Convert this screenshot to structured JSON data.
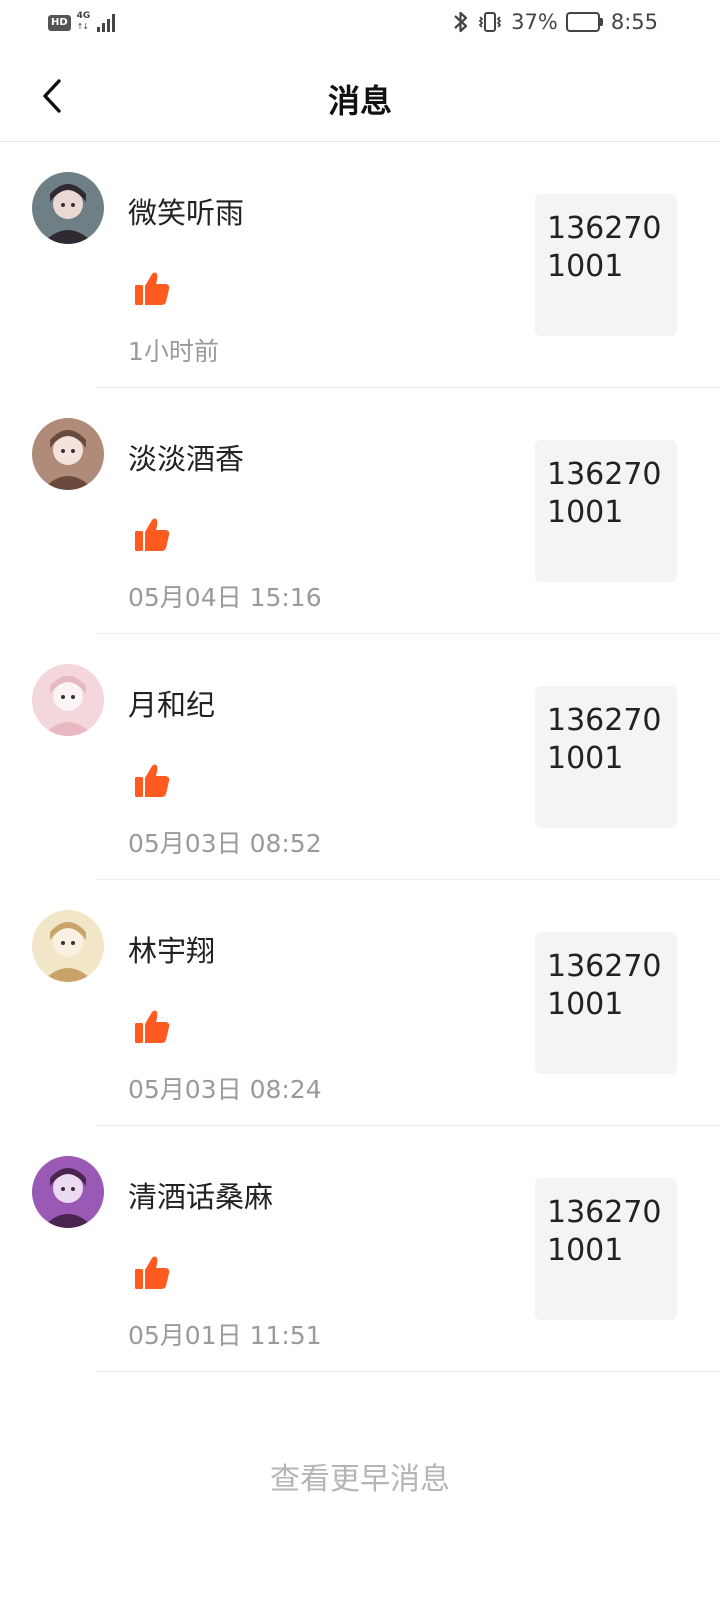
{
  "status_bar": {
    "hd_badge": "HD",
    "network": "4G",
    "battery_percent_label": "37%",
    "battery_level": 0.37,
    "time": "8:55",
    "icons": [
      "hd-icon",
      "network-4g-icon",
      "signal-icon",
      "bluetooth-icon",
      "vibrate-icon",
      "battery-icon"
    ]
  },
  "header": {
    "title": "消息",
    "back_icon": "chevron-left-icon"
  },
  "messages": [
    {
      "username": "微笑听雨",
      "time": "1小时前",
      "thumb_text": "1362701001",
      "avatar_colors": [
        "#6f7f86",
        "#e9d9d2",
        "#2f2a31"
      ]
    },
    {
      "username": "淡淡酒香",
      "time": "05月04日 15:16",
      "thumb_text": "1362701001",
      "avatar_colors": [
        "#b08b7a",
        "#f4e3dc",
        "#6a4a3d"
      ]
    },
    {
      "username": "月和纪",
      "time": "05月03日 08:52",
      "thumb_text": "1362701001",
      "avatar_colors": [
        "#f3d7dc",
        "#fbf3f4",
        "#e7b8c0"
      ]
    },
    {
      "username": "林宇翔",
      "time": "05月03日 08:24",
      "thumb_text": "1362701001",
      "avatar_colors": [
        "#f2e6c8",
        "#f9f1e2",
        "#c9a36a"
      ]
    },
    {
      "username": "清酒话桑麻",
      "time": "05月01日 11:51",
      "thumb_text": "1362701001",
      "avatar_colors": [
        "#9b59b6",
        "#ecd9f2",
        "#4a2550"
      ]
    }
  ],
  "like_color": "#ff5a1f",
  "footer": {
    "more_label": "查看更早消息"
  }
}
